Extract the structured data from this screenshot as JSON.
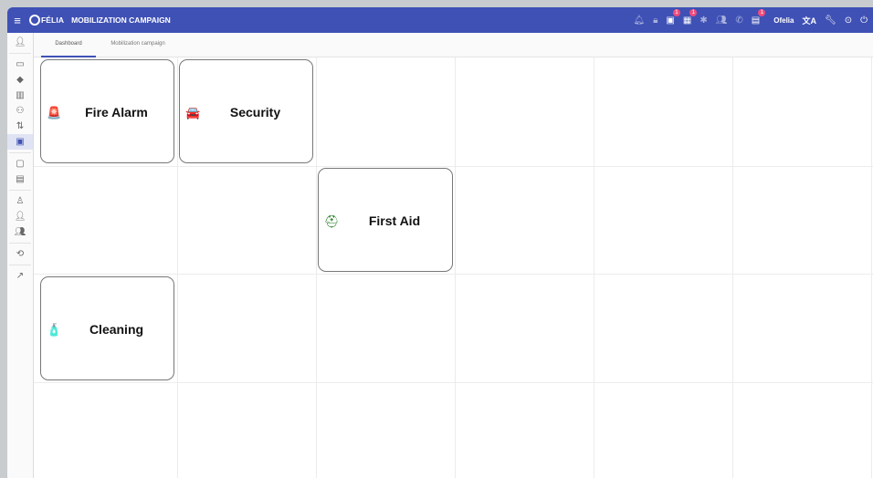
{
  "header": {
    "brand": "FÉLIA",
    "campaign_title": "MOBILIZATION CAMPAIGN",
    "username": "Ofelia",
    "translate_icon": "文A",
    "badges": {
      "alerts_a": "1",
      "alerts_b": "1",
      "alerts_c": "1"
    }
  },
  "tabs": [
    {
      "label": "Dashboard"
    },
    {
      "label": "Mobilization campaign"
    }
  ],
  "cards": [
    {
      "title": "Fire Alarm",
      "icon": "fire-alarm-icon",
      "glyph": "🚨",
      "color": "#d32f2f"
    },
    {
      "title": "Security",
      "icon": "security-car-icon",
      "glyph": "🚘",
      "color": "#1e3fb3"
    },
    {
      "title": "First Aid",
      "icon": "first-aid-bag-icon",
      "glyph": "⛑",
      "color": "#1b7a1b"
    },
    {
      "title": "Cleaning",
      "icon": "cleaning-spray-icon",
      "glyph": "🧴",
      "color": "#222222"
    }
  ]
}
